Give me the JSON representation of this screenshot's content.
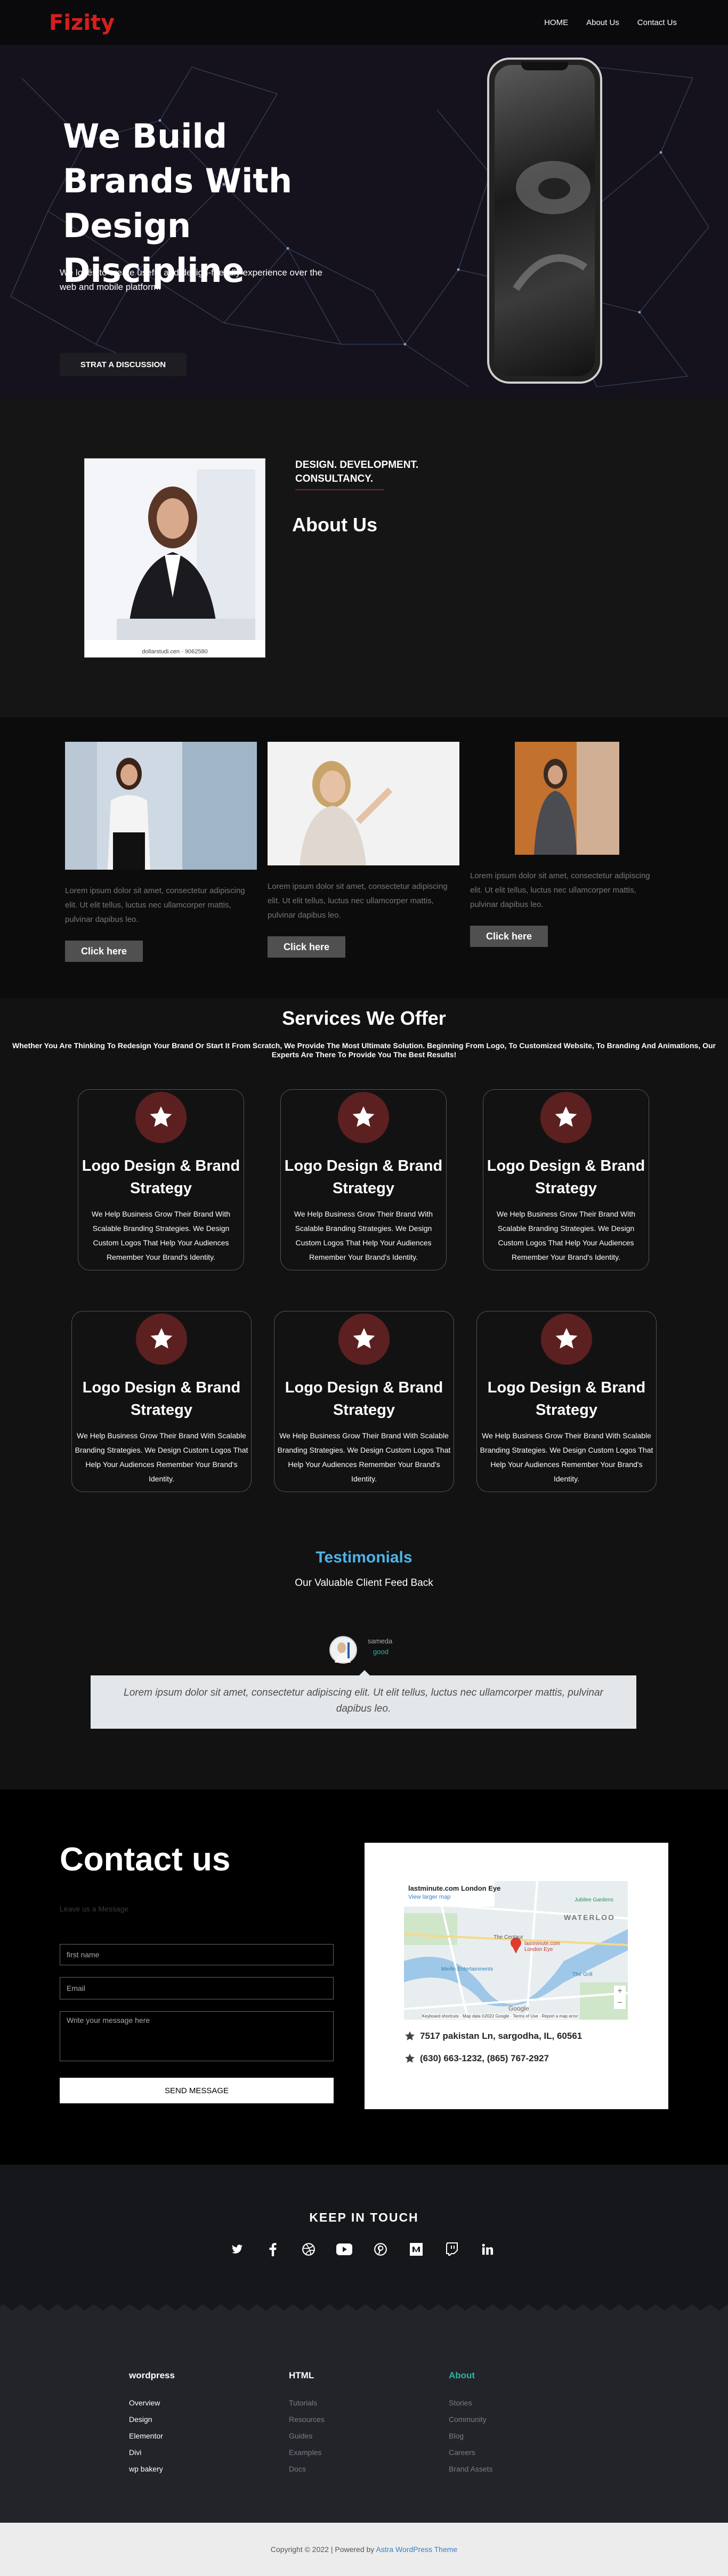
{
  "header": {
    "logo_text": "Fizity",
    "logo_color": "#d41f1f",
    "nav": [
      "HOME",
      "About Us",
      "Contact Us"
    ]
  },
  "hero": {
    "title": "We Build Brands With Design Discipline",
    "subtitle": "We lovés to create useful and design-friendly experience over the web and mobile platform.",
    "button": "STRAT A DISCUSSION"
  },
  "about": {
    "tagline": "DESIGN. DEVELOPMENT. CONSULTANCY.",
    "title": "About Us",
    "photo_caption": "dollarstudi.cen · 9062580"
  },
  "team": {
    "cards": [
      {
        "text": "Lorem ipsum dolor sit amet, consectetur adipiscing elit. Ut elit tellus, luctus nec ullamcorper mattis, pulvinar dapibus leo.",
        "button": "Click here"
      },
      {
        "text": "Lorem ipsum dolor sit amet, consectetur adipiscing elit. Ut elit tellus, luctus nec ullamcorper mattis, pulvinar dapibus leo.",
        "button": "Click here"
      },
      {
        "text": "Lorem ipsum dolor sit amet, consectetur adipiscing elit. Ut elit tellus, luctus nec ullamcorper mattis, pulvinar dapibus leo.",
        "button": "Click here"
      }
    ]
  },
  "services": {
    "title": "Services We Offer",
    "subtitle": "Whether You Are Thinking To Redesign Your Brand Or Start It From Scratch, We Provide The Most Ultimate Solution. Beginning From Logo, To Customized Website, To Branding And Animations, Our Experts Are There To Provide You The Best Results!",
    "icon": "star-icon",
    "accent": "#5d2020",
    "items": [
      {
        "title": "Logo Design & Brand Strategy",
        "text": "We Help Business Grow Their Brand With Scalable Branding Strategies. We Design Custom Logos That Help Your Audiences Remember Your Brand's Identity."
      },
      {
        "title": "Logo Design & Brand Strategy",
        "text": "We Help Business Grow Their Brand With Scalable Branding Strategies. We Design Custom Logos That Help Your Audiences Remember Your Brand's Identity."
      },
      {
        "title": "Logo Design & Brand Strategy",
        "text": "We Help Business Grow Their Brand With Scalable Branding Strategies. We Design Custom Logos That Help Your Audiences Remember Your Brand's Identity."
      },
      {
        "title": "Logo Design & Brand Strategy",
        "text": "We Help Business Grow Their Brand With Scalable Branding Strategies. We Design Custom Logos That Help Your Audiences Remember Your Brand's Identity."
      },
      {
        "title": "Logo Design & Brand Strategy",
        "text": "We Help Business Grow Their Brand With Scalable Branding Strategies. We Design Custom Logos That Help Your Audiences Remember Your Brand's Identity."
      },
      {
        "title": "Logo Design & Brand Strategy",
        "text": "We Help Business Grow Their Brand With Scalable Branding Strategies. We Design Custom Logos That Help Your Audiences Remember Your Brand's Identity."
      }
    ]
  },
  "testimonials": {
    "title": "Testimonials",
    "subtitle": "Our Valuable Client Feed Back",
    "name": "sameda",
    "role": "good",
    "quote": "Lorem ipsum dolor sit amet, consectetur adipiscing elit. Ut elit tellus, luctus nec ullamcorper mattis, pulvinar dapibus leo."
  },
  "contact": {
    "title": "Contact us",
    "hint": "Leave us a Message",
    "name_placeholder": "first name",
    "email_placeholder": "Email",
    "message_placeholder": "Write your message here",
    "button": "SEND MESSAGE",
    "map": {
      "place": "lastminute.com London Eye",
      "link": "View larger map",
      "labels": [
        "WATERLOO",
        "The Centaur",
        "Merlin Entertainments",
        "lastminute.com London Eye",
        "Jubilee Gardens",
        "The Grill"
      ],
      "footer": "Keyboard shortcuts · Map data ©2022 Google · Terms of Use · Report a map error",
      "google": "Google"
    },
    "address": "7517 pakistan Ln, sargodha, IL, 60561",
    "phone": "(630) 663-1232, (865) 767-2927"
  },
  "keep_in_touch": {
    "title": "KEEP IN TOUCH",
    "icons": [
      "twitter-icon",
      "facebook-icon",
      "dribbble-icon",
      "youtube-icon",
      "pinterest-icon",
      "medium-icon",
      "twitch-icon",
      "linkedin-icon"
    ]
  },
  "footer": {
    "columns": [
      {
        "title": "wordpress",
        "links": [
          "Overview",
          "Design",
          "Elementor",
          "Divi",
          "wp bakery"
        ],
        "title_color": "#ffffff",
        "link_color": "#ffffff"
      },
      {
        "title": "HTML",
        "links": [
          "Tutorials",
          "Resources",
          "Guides",
          "Examples",
          "Docs"
        ],
        "title_color": "#ffffff",
        "link_color": "#7a7d84"
      },
      {
        "title": "About",
        "links": [
          "Stories",
          "Community",
          "Blog",
          "Careers",
          "Brand Assets"
        ],
        "title_color": "#2cb5a0",
        "link_color": "#7a7d84"
      }
    ]
  },
  "copyright": {
    "text": "Copyright © 2022 | Powered by",
    "link": "Astra WordPress Theme"
  }
}
